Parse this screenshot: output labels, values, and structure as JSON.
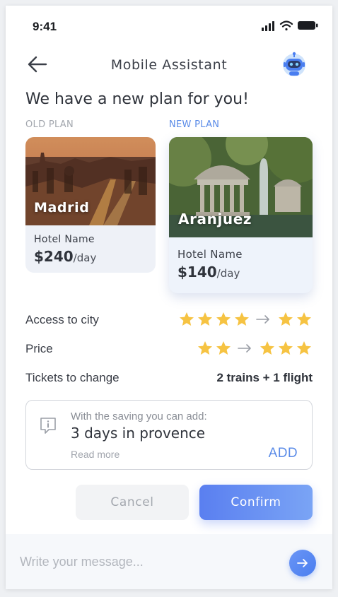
{
  "status_bar": {
    "time": "9:41",
    "icons": [
      "signal-icon",
      "wifi-icon",
      "battery-icon"
    ]
  },
  "header": {
    "title": "Mobile Assistant",
    "back_icon": "arrow-left-icon",
    "avatar_icon": "robot-icon"
  },
  "headline": "We have a new plan for you!",
  "plans": {
    "old": {
      "label": "OLD PLAN",
      "city": "Madrid",
      "hotel": "Hotel Name",
      "price": "$240",
      "unit": "/day"
    },
    "new": {
      "label": "NEW PLAN",
      "city": "Aranjuez",
      "hotel": "Hotel Name",
      "price": "$140",
      "unit": "/day"
    }
  },
  "comparison": [
    {
      "label": "Access to city",
      "from_stars": 4,
      "to_stars": 2
    },
    {
      "label": "Price",
      "from_stars": 2,
      "to_stars": 3
    },
    {
      "label": "Tickets to change",
      "value": "2 trains + 1 flight"
    }
  ],
  "saving": {
    "icon": "info-icon",
    "intro": "With the saving you can add:",
    "offer": "3 days in provence",
    "read_more": "Read more",
    "add_label": "ADD"
  },
  "actions": {
    "cancel_label": "Cancel",
    "confirm_label": "Confirm"
  },
  "composer": {
    "placeholder": "Write your message...",
    "value": "",
    "send_icon": "arrow-right-icon"
  },
  "colors": {
    "accent": "#5a8be8",
    "star": "#f6c342",
    "button_gradient_start": "#5a7ff0",
    "button_gradient_end": "#7aa4f5"
  }
}
